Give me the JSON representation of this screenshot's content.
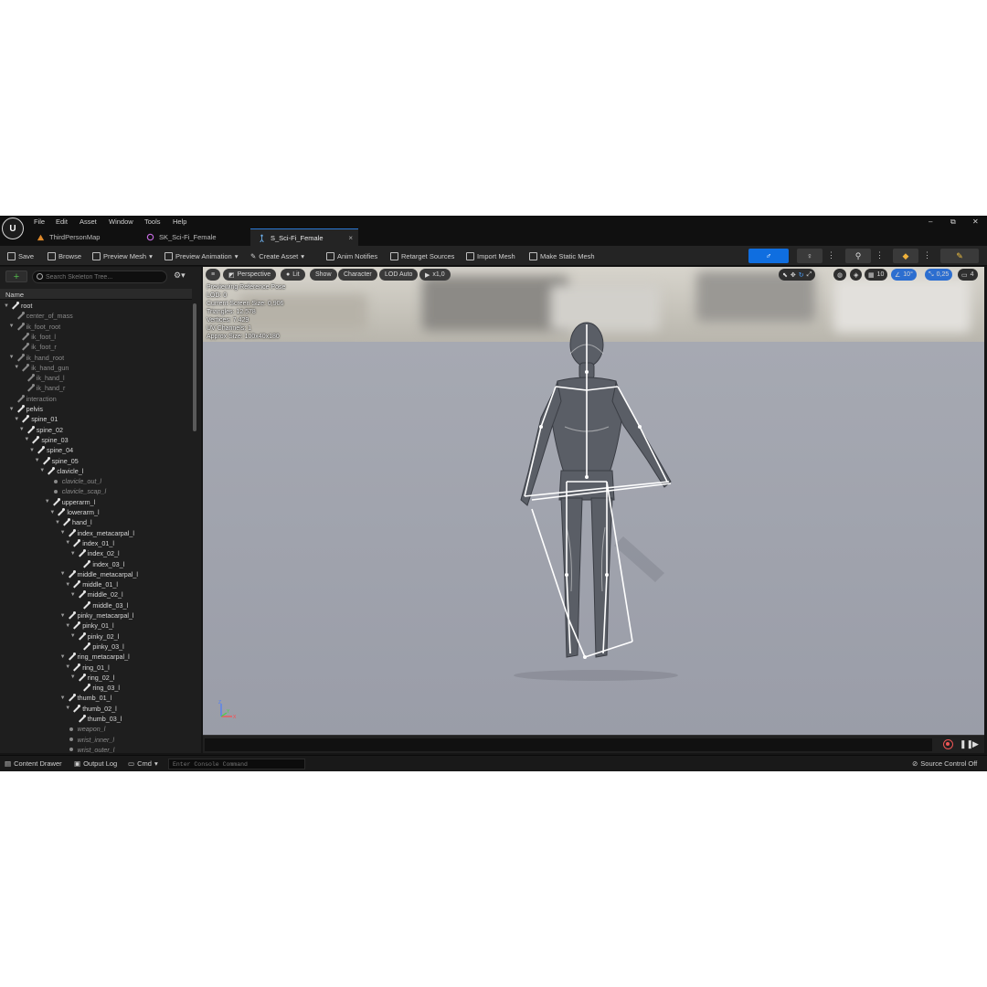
{
  "menu": {
    "items": [
      "File",
      "Edit",
      "Asset",
      "Window",
      "Tools",
      "Help"
    ]
  },
  "window_controls": {
    "minimize": "–",
    "maximize": "⧉",
    "close": "✕"
  },
  "tabs": [
    {
      "label": "ThirdPersonMap",
      "icon": "level-icon"
    },
    {
      "label": "SK_Sci-Fi_Female",
      "icon": "skeletal-mesh-icon"
    },
    {
      "label": "S_Sci-Fi_Female",
      "icon": "skeleton-icon",
      "close": "×"
    }
  ],
  "toolbar": {
    "save": "Save",
    "browse": "Browse",
    "preview_mesh": "Preview Mesh",
    "preview_animation": "Preview Animation",
    "create_asset": "Create Asset",
    "anim_notifies": "Anim Notifies",
    "retarget_sources": "Retarget Sources",
    "import_mesh": "Import Mesh",
    "make_static_mesh": "Make Static Mesh"
  },
  "left_panel": {
    "add": "+",
    "search_placeholder": "Search Skeleton Tree...",
    "column_header": "Name",
    "tree": [
      {
        "label": "root",
        "depth": 0,
        "type": "bone",
        "dim": false
      },
      {
        "label": "center_of_mass",
        "depth": 1,
        "type": "bone",
        "dim": true
      },
      {
        "label": "ik_foot_root",
        "depth": 1,
        "type": "bone",
        "dim": true
      },
      {
        "label": "ik_foot_l",
        "depth": 2,
        "type": "bone",
        "dim": true
      },
      {
        "label": "ik_foot_r",
        "depth": 2,
        "type": "bone",
        "dim": true
      },
      {
        "label": "ik_hand_root",
        "depth": 1,
        "type": "bone",
        "dim": true
      },
      {
        "label": "ik_hand_gun",
        "depth": 2,
        "type": "bone",
        "dim": true
      },
      {
        "label": "ik_hand_l",
        "depth": 3,
        "type": "bone",
        "dim": true
      },
      {
        "label": "ik_hand_r",
        "depth": 3,
        "type": "bone",
        "dim": true
      },
      {
        "label": "interaction",
        "depth": 1,
        "type": "bone",
        "dim": true
      },
      {
        "label": "pelvis",
        "depth": 1,
        "type": "bone",
        "dim": false
      },
      {
        "label": "spine_01",
        "depth": 2,
        "type": "bone",
        "dim": false
      },
      {
        "label": "spine_02",
        "depth": 3,
        "type": "bone",
        "dim": false
      },
      {
        "label": "spine_03",
        "depth": 4,
        "type": "bone",
        "dim": false
      },
      {
        "label": "spine_04",
        "depth": 5,
        "type": "bone",
        "dim": false
      },
      {
        "label": "spine_05",
        "depth": 6,
        "type": "bone",
        "dim": false
      },
      {
        "label": "clavicle_l",
        "depth": 7,
        "type": "bone",
        "dim": false
      },
      {
        "label": "clavicle_out_l",
        "depth": 8,
        "type": "socket",
        "dim": true
      },
      {
        "label": "clavicle_scap_l",
        "depth": 8,
        "type": "socket",
        "dim": true
      },
      {
        "label": "upperarm_l",
        "depth": 8,
        "type": "bone",
        "dim": false
      },
      {
        "label": "lowerarm_l",
        "depth": 9,
        "type": "bone",
        "dim": false
      },
      {
        "label": "hand_l",
        "depth": 10,
        "type": "bone",
        "dim": false
      },
      {
        "label": "index_metacarpal_l",
        "depth": 11,
        "type": "bone",
        "dim": false
      },
      {
        "label": "index_01_l",
        "depth": 12,
        "type": "bone",
        "dim": false
      },
      {
        "label": "index_02_l",
        "depth": 13,
        "type": "bone",
        "dim": false
      },
      {
        "label": "index_03_l",
        "depth": 14,
        "type": "bone",
        "dim": false
      },
      {
        "label": "middle_metacarpal_l",
        "depth": 11,
        "type": "bone",
        "dim": false
      },
      {
        "label": "middle_01_l",
        "depth": 12,
        "type": "bone",
        "dim": false
      },
      {
        "label": "middle_02_l",
        "depth": 13,
        "type": "bone",
        "dim": false
      },
      {
        "label": "middle_03_l",
        "depth": 14,
        "type": "bone",
        "dim": false
      },
      {
        "label": "pinky_metacarpal_l",
        "depth": 11,
        "type": "bone",
        "dim": false
      },
      {
        "label": "pinky_01_l",
        "depth": 12,
        "type": "bone",
        "dim": false
      },
      {
        "label": "pinky_02_l",
        "depth": 13,
        "type": "bone",
        "dim": false
      },
      {
        "label": "pinky_03_l",
        "depth": 14,
        "type": "bone",
        "dim": false
      },
      {
        "label": "ring_metacarpal_l",
        "depth": 11,
        "type": "bone",
        "dim": false
      },
      {
        "label": "ring_01_l",
        "depth": 12,
        "type": "bone",
        "dim": false
      },
      {
        "label": "ring_02_l",
        "depth": 13,
        "type": "bone",
        "dim": false
      },
      {
        "label": "ring_03_l",
        "depth": 14,
        "type": "bone",
        "dim": false
      },
      {
        "label": "thumb_01_l",
        "depth": 11,
        "type": "bone",
        "dim": false
      },
      {
        "label": "thumb_02_l",
        "depth": 12,
        "type": "bone",
        "dim": false
      },
      {
        "label": "thumb_03_l",
        "depth": 13,
        "type": "bone",
        "dim": false
      },
      {
        "label": "weapon_l",
        "depth": 11,
        "type": "socket",
        "dim": true
      },
      {
        "label": "wrist_inner_l",
        "depth": 11,
        "type": "socket",
        "dim": true
      },
      {
        "label": "wrist_outer_l",
        "depth": 11,
        "type": "socket",
        "dim": true
      }
    ]
  },
  "viewport": {
    "perspective": "Perspective",
    "lit": "Lit",
    "show": "Show",
    "character": "Character",
    "lod": "LOD Auto",
    "speed": "x1,0",
    "grid_size": "10",
    "rotation_snap": "10°",
    "scale_snap": "0,25",
    "camera_speed": "4",
    "info": [
      "Previewing Reference Pose",
      "LOD: 0",
      "Current Screen Size: 0,906",
      "Triangles: 12.578",
      "Vertices: 7.429",
      "UV Channels: 1",
      "Approx Size: 100x40x180"
    ],
    "gizmo": {
      "z": "Z",
      "x": "X",
      "y": "Y"
    }
  },
  "statusbar": {
    "content_drawer": "Content Drawer",
    "output_log": "Output Log",
    "cmd": "Cmd",
    "console_placeholder": "Enter Console Command",
    "source_control": "Source Control Off"
  },
  "colors": {
    "accent": "#0f6ee0",
    "panel_bg": "#1e1e1e",
    "toolbar_bg": "#242424",
    "add_green": "#53b94c"
  }
}
